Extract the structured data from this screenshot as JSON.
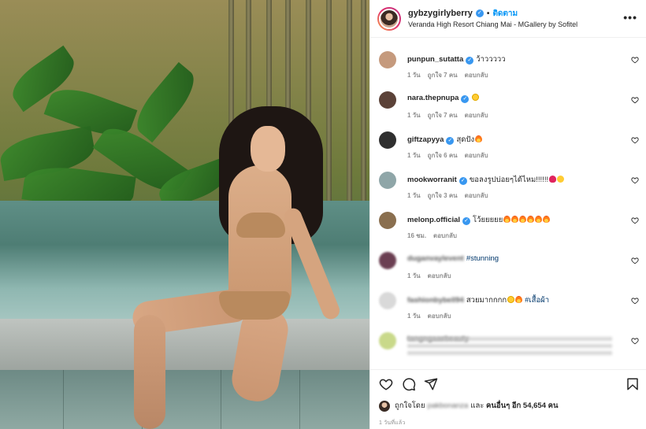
{
  "header": {
    "username": "gybzygirlyberry",
    "verified": true,
    "follow_label": "ติดตาม",
    "separator": "•",
    "location": "Veranda High Resort Chiang Mai - MGallery by Sofitel",
    "more_label": "•••"
  },
  "comments": [
    {
      "user": "punpun_sutatta",
      "verified": true,
      "text": "ว้าววววว",
      "emoji": [],
      "time": "1 วัน",
      "likes": "ถูกใจ 7 คน",
      "reply": "ตอบกลับ",
      "avatar_color": "#c59a7d",
      "blurred": false
    },
    {
      "user": "nara.thepnupa",
      "verified": true,
      "text": "",
      "emoji": [
        "heart-eyes"
      ],
      "time": "1 วัน",
      "likes": "ถูกใจ 7 คน",
      "reply": "ตอบกลับ",
      "avatar_color": "#5b4238",
      "blurred": false
    },
    {
      "user": "giftzapyya",
      "verified": true,
      "text": "สุดปัง",
      "emoji": [
        "fire"
      ],
      "time": "1 วัน",
      "likes": "ถูกใจ 6 คน",
      "reply": "ตอบกลับ",
      "avatar_color": "#2f2f2f",
      "blurred": false
    },
    {
      "user": "mookworranit",
      "verified": true,
      "text": "ขอลงรูปบ่อยๆได้ไหม!!!!!!",
      "emoji": [
        "red-heart",
        "laugh"
      ],
      "time": "1 วัน",
      "likes": "ถูกใจ 3 คน",
      "reply": "ตอบกลับ",
      "avatar_color": "#8fa6a8",
      "blurred": false
    },
    {
      "user": "melonp.official",
      "verified": true,
      "text": "โว้ยยยยย",
      "emoji": [
        "fire",
        "fire",
        "fire",
        "fire",
        "fire",
        "fire"
      ],
      "time": "16 ชม.",
      "likes": "",
      "reply": "ตอบกลับ",
      "avatar_color": "#8a6f4f",
      "blurred": false
    },
    {
      "user": "duganvaylevent",
      "verified": false,
      "text": "#stunning",
      "emoji": [],
      "time": "1 วัน",
      "likes": "",
      "reply": "ตอบกลับ",
      "avatar_color": "#6b3f52",
      "blurred": true
    },
    {
      "user": "fashionbybell94",
      "verified": false,
      "text": "สวยมากกกก",
      "emoji": [
        "heart-eyes",
        "fire"
      ],
      "hashtag": "#เสื้อผ้า",
      "time": "1 วัน",
      "likes": "",
      "reply": "ตอบกลับ",
      "avatar_color": "#d9d9d9",
      "blurred": true
    },
    {
      "user": "tangngaaebeauty",
      "verified": false,
      "text": "",
      "emoji": [],
      "time": "",
      "likes": "",
      "reply": "",
      "avatar_color": "#c9d98a",
      "blurred": true
    }
  ],
  "actions": {
    "like_icon": "heart-icon",
    "comment_icon": "comment-icon",
    "share_icon": "share-icon",
    "save_icon": "bookmark-icon"
  },
  "likes_summary": {
    "prefix": "ถูกใจโดย",
    "liker": "pakbonanza",
    "middle": "และ",
    "others": "คนอื่นๆ อีก 54,654 คน"
  },
  "timestamp": "1 วันที่แล้ว",
  "colors": {
    "accent": "#0095f6",
    "verified": "#3897f0",
    "meta": "#8e8e8e",
    "border": "#efefef"
  }
}
